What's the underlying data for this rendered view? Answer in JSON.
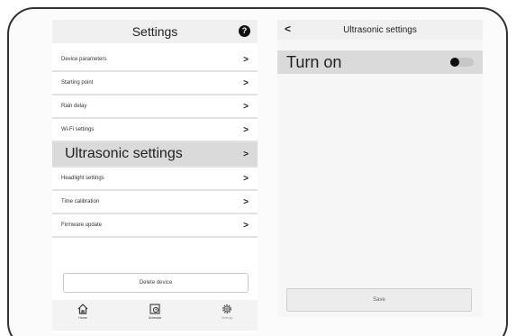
{
  "left": {
    "title": "Settings",
    "help_glyph": "?",
    "menu": [
      {
        "label": "Device parameters"
      },
      {
        "label": "Starting point"
      },
      {
        "label": "Rain delay"
      },
      {
        "label": "Wi-Fi settings"
      },
      {
        "label": "Ultrasonic settings",
        "active": true
      },
      {
        "label": "Headlight settings"
      },
      {
        "label": "Time calibration"
      },
      {
        "label": "Firmware update"
      }
    ],
    "chevron": ">",
    "delete_label": "Delete device",
    "tabs": [
      {
        "label": "Home",
        "icon": "home-icon"
      },
      {
        "label": "Schedule",
        "icon": "schedule-icon"
      },
      {
        "label": "Settings",
        "icon": "gear-icon"
      }
    ]
  },
  "right": {
    "back_glyph": "<",
    "title": "Ultrasonic settings",
    "toggle_label": "Turn on",
    "toggle_on": false,
    "save_label": "Save"
  },
  "colors": {
    "active_row": "#dadada",
    "header_bg": "#f0f0f0",
    "toggle_knob": "#111111",
    "toggle_track": "#c7c7c7"
  }
}
